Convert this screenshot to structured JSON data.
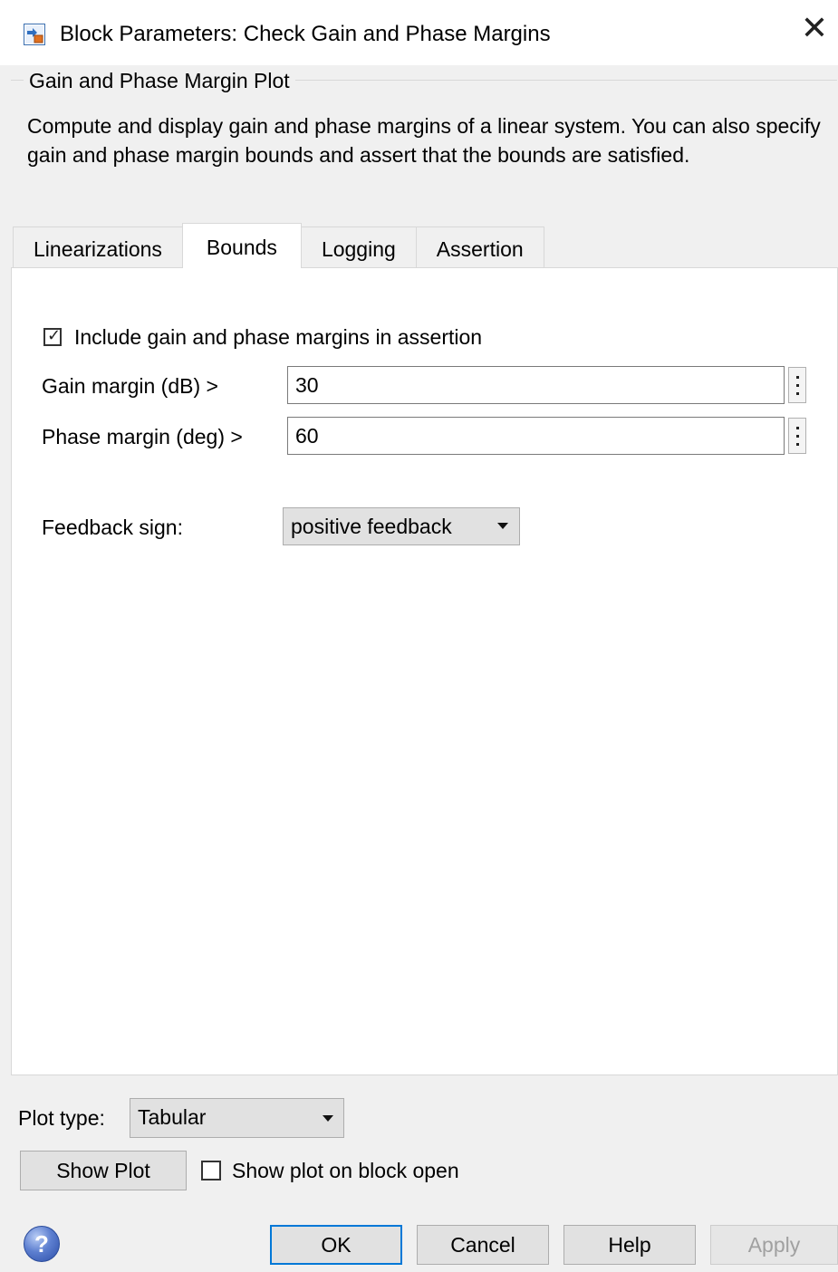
{
  "window": {
    "title": "Block Parameters: Check Gain and Phase Margins",
    "close_glyph": "✕"
  },
  "group": {
    "legend": "Gain and Phase Margin Plot",
    "description": "Compute and display gain and phase margins of a linear system. You can also specify gain and phase margin bounds and assert that the bounds are satisfied."
  },
  "tabs": [
    {
      "label": "Linearizations",
      "active": false
    },
    {
      "label": "Bounds",
      "active": true
    },
    {
      "label": "Logging",
      "active": false
    },
    {
      "label": "Assertion",
      "active": false
    }
  ],
  "bounds": {
    "include_checkbox": {
      "label": "Include gain and phase margins in assertion",
      "checked": true
    },
    "gain_margin": {
      "label": "Gain margin (dB) >",
      "value": "30"
    },
    "phase_margin": {
      "label": "Phase margin (deg) >",
      "value": "60"
    },
    "feedback_sign": {
      "label": "Feedback sign:",
      "value": "positive feedback"
    }
  },
  "plot": {
    "type_label": "Plot type:",
    "type_value": "Tabular",
    "show_plot_button": "Show Plot",
    "show_on_open": {
      "label": "Show plot on block open",
      "checked": false
    }
  },
  "footer": {
    "help_glyph": "?",
    "ok": "OK",
    "cancel": "Cancel",
    "help": "Help",
    "apply": "Apply",
    "apply_enabled": false
  },
  "colors": {
    "accent": "#0078d7",
    "window_bg": "#f0f0f0",
    "panel_bg": "#ffffff"
  }
}
